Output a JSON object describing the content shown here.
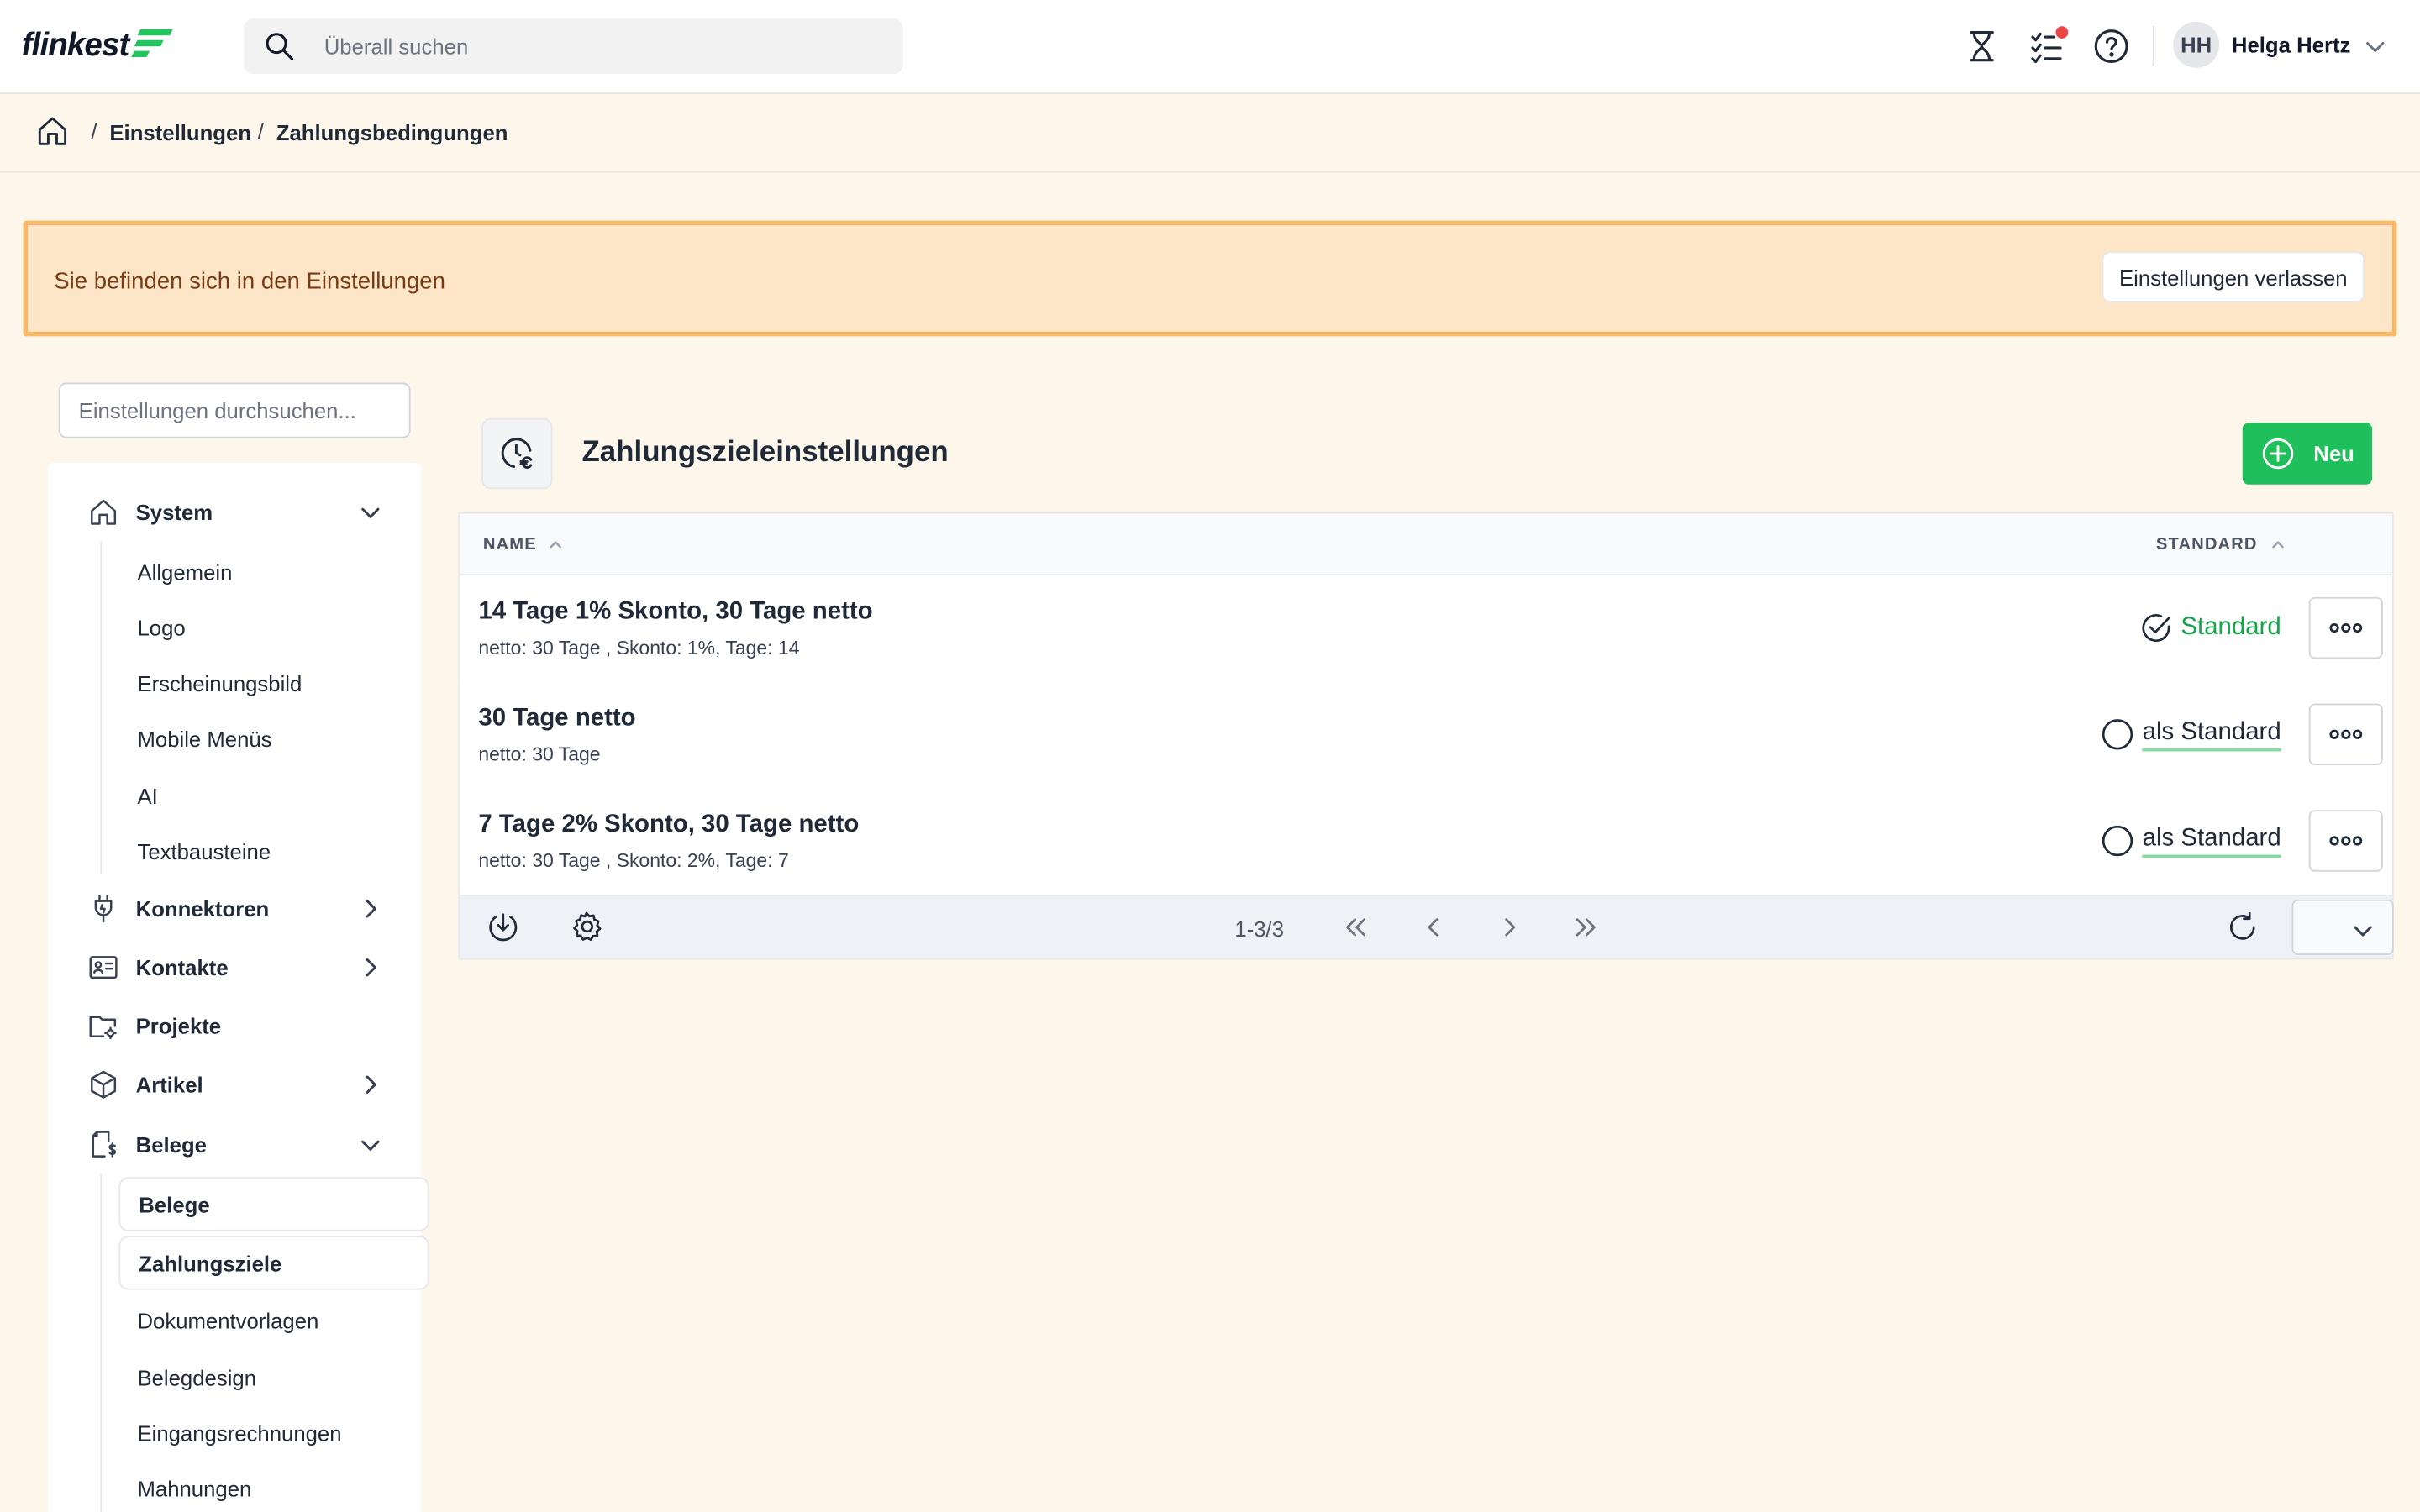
{
  "header": {
    "logo_text": "flinkest",
    "search_placeholder": "Überall suchen",
    "icons": [
      "hourglass-icon",
      "task-checklist-icon",
      "help-icon",
      "chevron-down-icon"
    ],
    "user": {
      "initials": "HH",
      "name": "Helga Hertz"
    }
  },
  "breadcrumb": {
    "separator": "/",
    "items": [
      "Einstellungen",
      "Zahlungsbedingungen"
    ]
  },
  "banner": {
    "text": "Sie befinden sich in den Einstellungen",
    "button": "Einstellungen verlassen"
  },
  "sidebar": {
    "search_placeholder": "Einstellungen durchsuchen...",
    "groups": [
      {
        "label": "System",
        "icon": "home-icon",
        "expanded": true,
        "items": [
          "Allgemein",
          "Logo",
          "Erscheinungsbild",
          "Mobile Menüs",
          "AI",
          "Textbausteine"
        ]
      },
      {
        "label": "Konnektoren",
        "icon": "plug-icon",
        "expanded": false
      },
      {
        "label": "Kontakte",
        "icon": "contact-card-icon",
        "expanded": false
      },
      {
        "label": "Projekte",
        "icon": "folder-gear-icon",
        "expanded": false
      },
      {
        "label": "Artikel",
        "icon": "box-icon",
        "expanded": false
      },
      {
        "label": "Belege",
        "icon": "receipt-icon",
        "expanded": true,
        "items": [
          "Belege",
          "Zahlungsziele",
          "Dokumentvorlagen",
          "Belegdesign",
          "Eingangsrechnungen",
          "Mahnungen"
        ],
        "selected": "Zahlungsziele"
      }
    ]
  },
  "main": {
    "title": "Zahlungszieleinstellungen",
    "title_icon": "clock-euro-icon",
    "new_button": "Neu",
    "table": {
      "columns": {
        "name": "NAME",
        "standard": "STANDARD"
      },
      "rows": [
        {
          "title": "14 Tage 1% Skonto, 30 Tage netto",
          "subtitle": "netto: 30 Tage , Skonto: 1%, Tage: 14",
          "is_default": true,
          "standard_label": "Standard"
        },
        {
          "title": "30 Tage netto",
          "subtitle": "netto: 30 Tage",
          "is_default": false,
          "standard_label": "als Standard"
        },
        {
          "title": "7 Tage 2% Skonto, 30 Tage netto",
          "subtitle": "netto: 30 Tage , Skonto: 2%, Tage: 7",
          "is_default": false,
          "standard_label": "als Standard"
        }
      ],
      "pagination": {
        "info": "1-3/3"
      }
    }
  },
  "colors": {
    "accent_green": "#1fbf5b",
    "banner_bg": "#fde5c8",
    "banner_border": "#f6b96a",
    "page_bg": "#fdf6ea"
  }
}
